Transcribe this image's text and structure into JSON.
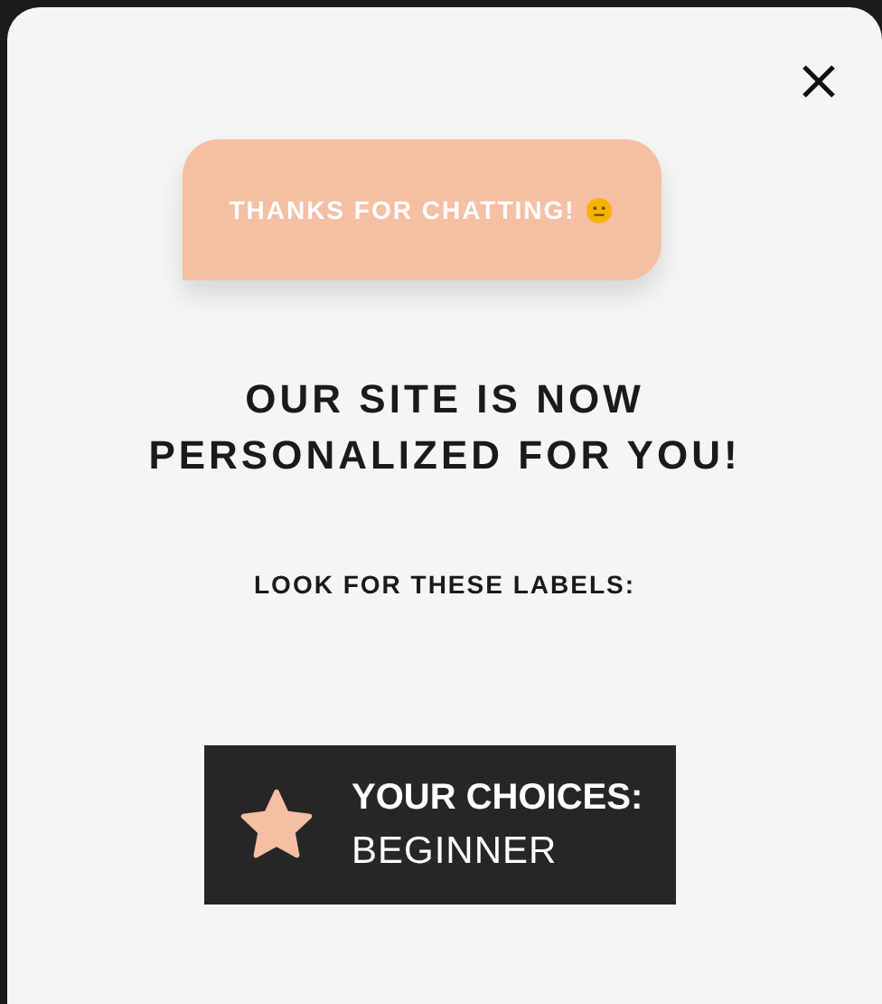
{
  "chat_bubble": {
    "text": "THANKS FOR CHATTING!"
  },
  "heading": "OUR SITE IS NOW PERSONALIZED FOR YOU!",
  "subheading": "LOOK FOR THESE LABELS:",
  "label": {
    "title": "YOUR CHOICES:",
    "value": "BEGINNER"
  }
}
